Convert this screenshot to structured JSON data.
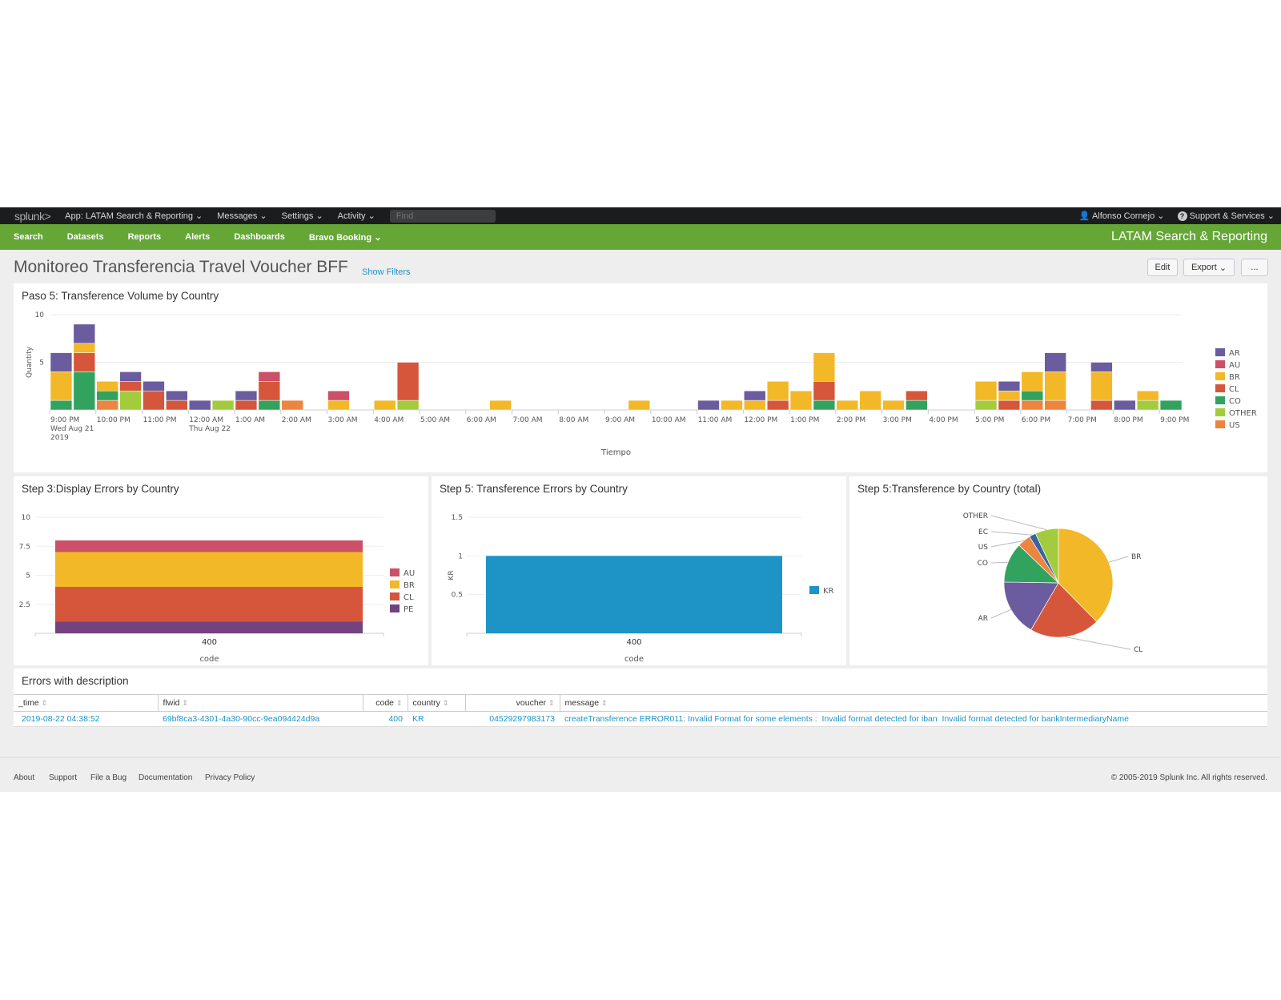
{
  "topbar": {
    "logo": "splunk",
    "menus": [
      "App: LATAM Search & Reporting",
      "Messages",
      "Settings",
      "Activity"
    ],
    "find_placeholder": "Find",
    "user": "Alfonso Cornejo",
    "support": "Support & Services"
  },
  "appbar": {
    "nav": [
      "Search",
      "Datasets",
      "Reports",
      "Alerts",
      "Dashboards",
      "Bravo Booking"
    ],
    "app_name": "LATAM Search & Reporting"
  },
  "dashboard": {
    "title": "Monitoreo Transferencia Travel Voucher BFF",
    "show_filters": "Show Filters",
    "edit": "Edit",
    "export": "Export",
    "more": "..."
  },
  "colors": {
    "AR": "#6a5c9e",
    "AU": "#cc5068",
    "BR": "#f2b827",
    "CL": "#d6563c",
    "CO": "#31a35f",
    "OTHER": "#a2cc3e",
    "US": "#ed8440",
    "PE": "#73427f",
    "KR": "#1e93c6",
    "EC": "#3863a0"
  },
  "chart_data": [
    {
      "type": "bar",
      "stacked": true,
      "title": "Paso 5: Transference Volume by Country",
      "xlabel": "Tiempo",
      "ylabel": "Quantity",
      "ylim": [
        0,
        10
      ],
      "yticks": [
        "10",
        "5"
      ],
      "xticks": [
        "9:00 PM",
        "10:00 PM",
        "11:00 PM",
        "12:00 AM",
        "1:00 AM",
        "2:00 AM",
        "3:00 AM",
        "4:00 AM",
        "5:00 AM",
        "6:00 AM",
        "7:00 AM",
        "8:00 AM",
        "9:00 AM",
        "10:00 AM",
        "11:00 AM",
        "12:00 PM",
        "1:00 PM",
        "2:00 PM",
        "3:00 PM",
        "4:00 PM",
        "5:00 PM",
        "6:00 PM",
        "7:00 PM",
        "8:00 PM",
        "9:00 PM"
      ],
      "xtick_sub": {
        "0": [
          "Wed Aug 21",
          "2019"
        ],
        "3": [
          "Thu Aug 22"
        ]
      },
      "bucket": "30m",
      "categories": [
        "21:00",
        "21:30",
        "22:00",
        "22:30",
        "23:00",
        "23:30",
        "00:00",
        "00:30",
        "01:00",
        "01:30",
        "02:00",
        "02:30",
        "03:00",
        "03:30",
        "04:00",
        "04:30",
        "05:00",
        "05:30",
        "06:00",
        "06:30",
        "07:00",
        "07:30",
        "08:00",
        "08:30",
        "09:00",
        "09:30",
        "10:00",
        "10:30",
        "11:00",
        "11:30",
        "12:00",
        "12:30",
        "13:00",
        "13:30",
        "14:00",
        "14:30",
        "15:00",
        "15:30",
        "16:00",
        "16:30",
        "17:00",
        "17:30",
        "18:00",
        "18:30",
        "19:00",
        "19:30",
        "20:00",
        "20:30",
        "21:00"
      ],
      "legend": [
        "AR",
        "AU",
        "BR",
        "CL",
        "CO",
        "OTHER",
        "US"
      ],
      "legend_position": "right",
      "series": [
        {
          "name": "US",
          "values": [
            0,
            0,
            1,
            0,
            0,
            0,
            0,
            0,
            0,
            0,
            1,
            0,
            0,
            0,
            0,
            0,
            0,
            0,
            0,
            0,
            0,
            0,
            0,
            0,
            0,
            0,
            0,
            0,
            0,
            0,
            0,
            0,
            0,
            0,
            0,
            0,
            0,
            0,
            0,
            0,
            0,
            0,
            1,
            1,
            0,
            0,
            0,
            0,
            0
          ]
        },
        {
          "name": "OTHER",
          "values": [
            0,
            0,
            0,
            2,
            0,
            0,
            0,
            1,
            0,
            0,
            0,
            0,
            0,
            0,
            0,
            1,
            0,
            0,
            0,
            0,
            0,
            0,
            0,
            0,
            0,
            0,
            0,
            0,
            0,
            0,
            0,
            0,
            0,
            0,
            0,
            0,
            0,
            0,
            0,
            0,
            1,
            0,
            0,
            0,
            0,
            0,
            0,
            1,
            0
          ]
        },
        {
          "name": "CO",
          "values": [
            1,
            4,
            1,
            0,
            0,
            0,
            0,
            0,
            0,
            1,
            0,
            0,
            0,
            0,
            0,
            0,
            0,
            0,
            0,
            0,
            0,
            0,
            0,
            0,
            0,
            0,
            0,
            0,
            0,
            0,
            0,
            0,
            0,
            1,
            0,
            0,
            0,
            1,
            0,
            0,
            0,
            0,
            1,
            0,
            0,
            0,
            0,
            0,
            1
          ]
        },
        {
          "name": "CL",
          "values": [
            0,
            2,
            0,
            1,
            2,
            1,
            0,
            0,
            1,
            2,
            0,
            0,
            0,
            0,
            0,
            4,
            0,
            0,
            0,
            0,
            0,
            0,
            0,
            0,
            0,
            0,
            0,
            0,
            0,
            0,
            0,
            1,
            0,
            2,
            0,
            0,
            0,
            1,
            0,
            0,
            0,
            1,
            0,
            0,
            0,
            1,
            0,
            0,
            0
          ]
        },
        {
          "name": "BR",
          "values": [
            3,
            1,
            1,
            0,
            0,
            0,
            0,
            0,
            0,
            0,
            0,
            0,
            1,
            0,
            1,
            0,
            0,
            0,
            0,
            1,
            0,
            0,
            0,
            0,
            0,
            1,
            0,
            0,
            0,
            1,
            1,
            2,
            2,
            3,
            1,
            2,
            1,
            0,
            0,
            0,
            2,
            1,
            2,
            3,
            0,
            3,
            0,
            1,
            0
          ]
        },
        {
          "name": "AU",
          "values": [
            0,
            0,
            0,
            0,
            0,
            0,
            0,
            0,
            0,
            1,
            0,
            0,
            1,
            0,
            0,
            0,
            0,
            0,
            0,
            0,
            0,
            0,
            0,
            0,
            0,
            0,
            0,
            0,
            0,
            0,
            0,
            0,
            0,
            0,
            0,
            0,
            0,
            0,
            0,
            0,
            0,
            0,
            0,
            0,
            0,
            0,
            0,
            0,
            0
          ]
        },
        {
          "name": "AR",
          "values": [
            2,
            2,
            0,
            1,
            1,
            1,
            1,
            0,
            1,
            0,
            0,
            0,
            0,
            0,
            0,
            0,
            0,
            0,
            0,
            0,
            0,
            0,
            0,
            0,
            0,
            0,
            0,
            0,
            1,
            0,
            1,
            0,
            0,
            0,
            0,
            0,
            0,
            0,
            0,
            0,
            0,
            1,
            0,
            2,
            0,
            1,
            1,
            0,
            0
          ]
        }
      ]
    },
    {
      "type": "bar",
      "stacked": true,
      "title": "Step 3:Display Errors by Country",
      "xlabel": "code",
      "ylabel": "",
      "ylim": [
        0,
        10
      ],
      "yticks": [
        "10",
        "7.5",
        "5",
        "2.5"
      ],
      "categories": [
        "400"
      ],
      "legend": [
        "AU",
        "BR",
        "CL",
        "PE"
      ],
      "legend_position": "right",
      "series": [
        {
          "name": "PE",
          "values": [
            1
          ]
        },
        {
          "name": "CL",
          "values": [
            3
          ]
        },
        {
          "name": "BR",
          "values": [
            3
          ]
        },
        {
          "name": "AU",
          "values": [
            1
          ]
        }
      ]
    },
    {
      "type": "bar",
      "title": "Step 5: Transference Errors by Country",
      "xlabel": "code",
      "ylabel": "KR",
      "ylim": [
        0,
        1.5
      ],
      "yticks": [
        "1.5",
        "1",
        "0.5"
      ],
      "categories": [
        "400"
      ],
      "legend": [
        "KR"
      ],
      "legend_position": "right",
      "series": [
        {
          "name": "KR",
          "values": [
            1
          ]
        }
      ]
    },
    {
      "type": "pie",
      "title": "Step 5:Transference by Country (total)",
      "labels": [
        "BR",
        "CL",
        "AR",
        "CO",
        "US",
        "EC",
        "OTHER"
      ],
      "values": [
        38,
        21,
        17,
        12,
        4,
        2,
        7
      ]
    }
  ],
  "errors_table": {
    "title": "Errors with description",
    "columns": [
      "_time",
      "flwid",
      "code",
      "country",
      "voucher",
      "message"
    ],
    "rows": [
      [
        "2019-08-22 04:38:52",
        "69bf8ca3-4301-4a30-90cc-9ea094424d9a",
        "400",
        "KR",
        "04529297983173",
        "createTransference ERROR011: Invalid Format for some elements :  Invalid format detected for iban  Invalid format detected for bankIntermediaryName"
      ]
    ]
  },
  "footer": {
    "links": [
      "About",
      "Support",
      "File a Bug",
      "Documentation",
      "Privacy Policy"
    ],
    "copyright": "© 2005-2019 Splunk Inc. All rights reserved."
  }
}
